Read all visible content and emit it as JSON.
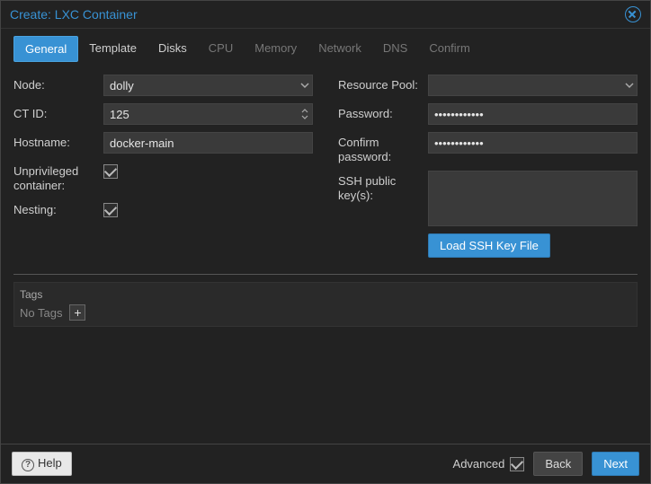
{
  "dialog_title": "Create: LXC Container",
  "tabs": [
    {
      "label": "General",
      "state": "active"
    },
    {
      "label": "Template",
      "state": "normal"
    },
    {
      "label": "Disks",
      "state": "normal"
    },
    {
      "label": "CPU",
      "state": "disabled"
    },
    {
      "label": "Memory",
      "state": "disabled"
    },
    {
      "label": "Network",
      "state": "disabled"
    },
    {
      "label": "DNS",
      "state": "disabled"
    },
    {
      "label": "Confirm",
      "state": "disabled"
    }
  ],
  "left": {
    "node_label": "Node:",
    "node_value": "dolly",
    "ctid_label": "CT ID:",
    "ctid_value": "125",
    "hostname_label": "Hostname:",
    "hostname_value": "docker-main",
    "unpriv_label": "Unprivileged container:",
    "unpriv_checked": true,
    "nesting_label": "Nesting:",
    "nesting_checked": true
  },
  "right": {
    "pool_label": "Resource Pool:",
    "pool_value": "",
    "pass_label": "Password:",
    "pass_value": "••••••••••••",
    "confirm_label": "Confirm password:",
    "confirm_value": "••••••••••••",
    "ssh_label": "SSH public key(s):",
    "ssh_value": "",
    "load_button": "Load SSH Key File"
  },
  "tags": {
    "heading": "Tags",
    "no_tags_text": "No Tags"
  },
  "footer": {
    "help": "Help",
    "advanced": "Advanced",
    "advanced_checked": true,
    "back": "Back",
    "next": "Next"
  }
}
